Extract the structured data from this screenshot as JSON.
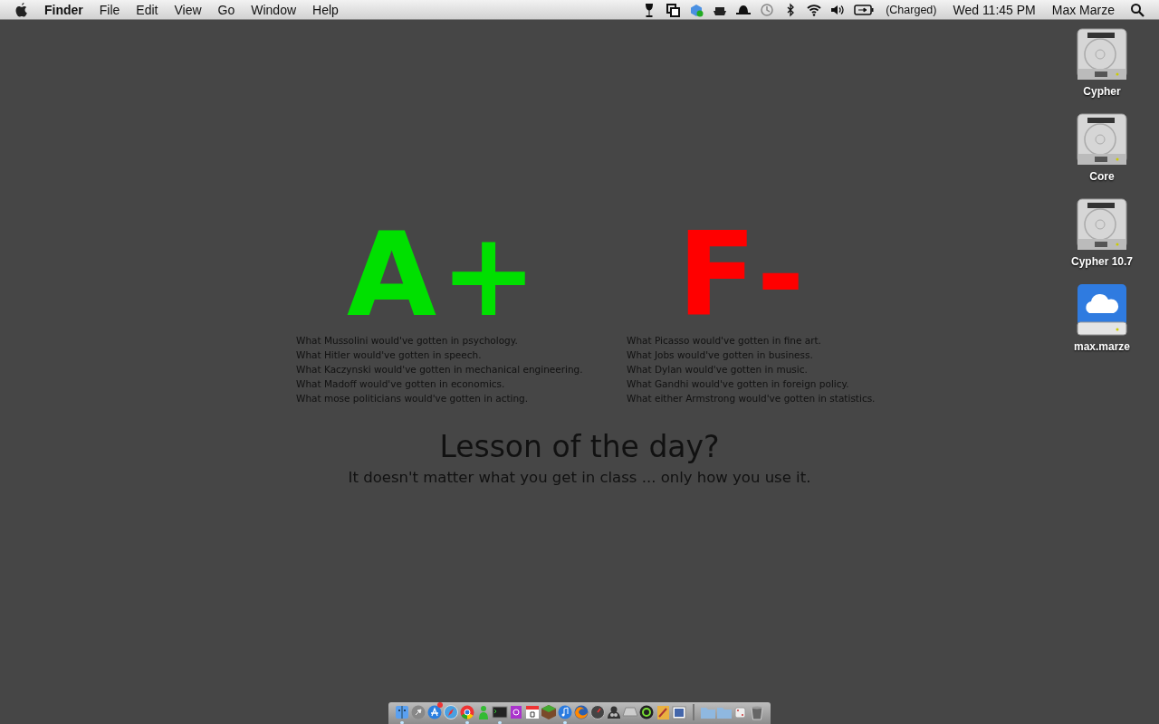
{
  "menu_bar": {
    "app_name": "Finder",
    "menus": [
      "File",
      "Edit",
      "View",
      "Go",
      "Window",
      "Help"
    ],
    "battery_status": "(Charged)",
    "clock": "Wed 11:45 PM",
    "user_name": "Max Marze"
  },
  "wallpaper": {
    "grades": [
      {
        "grade": "A+",
        "color": "#00e000",
        "lines": [
          "What Mussolini would've gotten in psychology.",
          "What Hitler would've gotten in speech.",
          "What Kaczynski would've gotten in mechanical engineering.",
          "What Madoff would've gotten in economics.",
          "What mose politicians would've gotten in acting."
        ]
      },
      {
        "grade": "F-",
        "color": "#ff0000",
        "lines": [
          "What Picasso would've gotten in fine art.",
          "What Jobs would've gotten in business.",
          "What Dylan would've gotten in music.",
          "What Gandhi would've gotten in foreign policy.",
          "What either Armstrong would've gotten in statistics."
        ]
      }
    ],
    "heading": "Lesson of the day?",
    "subheading": "It doesn't matter what you get in class ... only how you use it."
  },
  "desktop_icons": [
    {
      "kind": "hard_drive",
      "label": "Cypher"
    },
    {
      "kind": "hard_drive",
      "label": "Core"
    },
    {
      "kind": "hard_drive",
      "label": "Cypher 10.7"
    },
    {
      "kind": "cloud_drive",
      "label": "max.marze"
    }
  ],
  "dock": {
    "apps": [
      {
        "running": true,
        "badge": false
      },
      {
        "running": false,
        "badge": false
      },
      {
        "running": false,
        "badge": true
      },
      {
        "running": false,
        "badge": false
      },
      {
        "running": true,
        "badge": false
      },
      {
        "running": false,
        "badge": false
      },
      {
        "running": true,
        "badge": false
      },
      {
        "running": false,
        "badge": false
      },
      {
        "running": false,
        "badge": false
      },
      {
        "running": false,
        "badge": false
      },
      {
        "running": true,
        "badge": false
      },
      {
        "running": false,
        "badge": false
      },
      {
        "running": false,
        "badge": false
      },
      {
        "running": false,
        "badge": false
      },
      {
        "running": false,
        "badge": false
      },
      {
        "running": false,
        "badge": false
      },
      {
        "running": false,
        "badge": false
      },
      {
        "running": false,
        "badge": false
      }
    ],
    "stacks": [
      {
        "kind": "folder"
      },
      {
        "kind": "folder"
      },
      {
        "kind": "dice"
      },
      {
        "kind": "trash"
      }
    ]
  }
}
